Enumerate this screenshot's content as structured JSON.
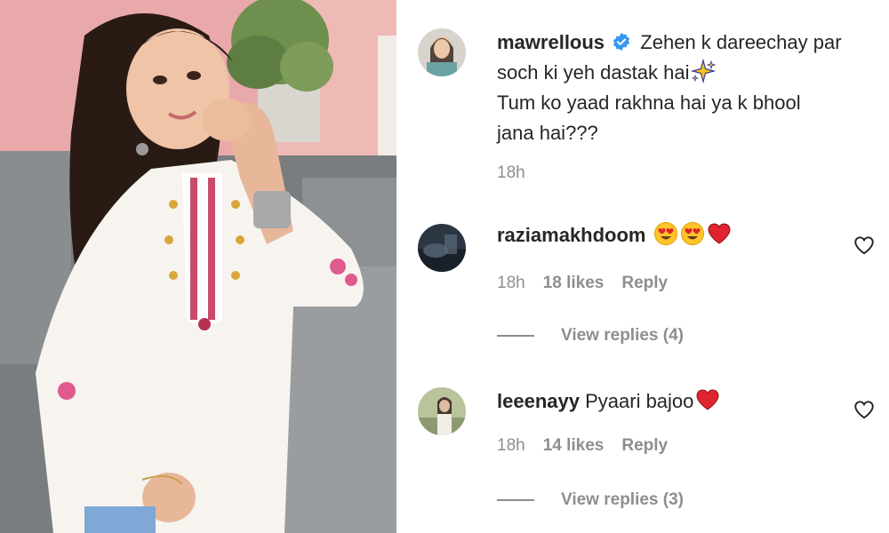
{
  "caption": {
    "username": "mawrellous",
    "text_line1": "Zehen k dareechay par",
    "text_line2": "soch ki yeh dastak hai",
    "text_line3": "Tum ko yaad rakhna hai ya k bhool",
    "text_line4": "jana hai???",
    "time": "18h",
    "emoji": "sparkles-icon"
  },
  "comments": [
    {
      "username": "raziamakhdoom",
      "text": "",
      "emojis": [
        "heart-eyes-emoji",
        "heart-eyes-emoji",
        "red-heart-emoji"
      ],
      "time": "18h",
      "likes": "18 likes",
      "reply_label": "Reply",
      "view_replies": "View replies (4)"
    },
    {
      "username": "leeenayy",
      "text": "Pyaari bajoo",
      "emojis": [
        "red-heart-emoji"
      ],
      "time": "18h",
      "likes": "14 likes",
      "reply_label": "Reply",
      "view_replies": "View replies (3)"
    }
  ],
  "colors": {
    "verified_blue": "#3897f0",
    "meta_gray": "#8e8e8e",
    "text_dark": "#262626",
    "heart_red": "#e0242f"
  }
}
